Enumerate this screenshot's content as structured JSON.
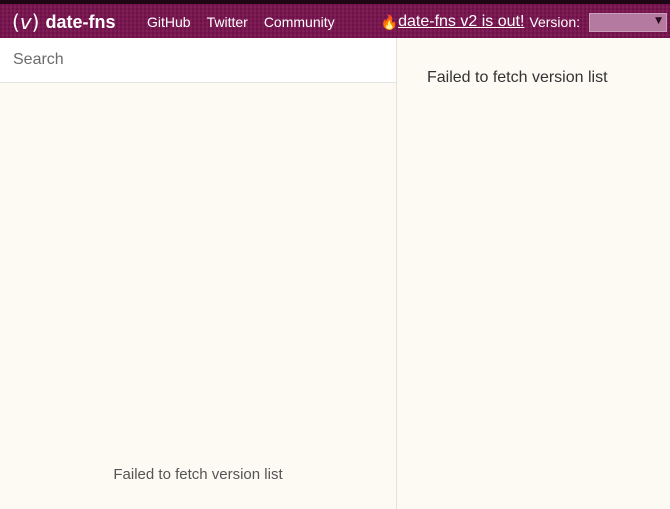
{
  "header": {
    "logo_icon": "(⁄)",
    "logo_text": "date-fns",
    "nav": [
      "GitHub",
      "Twitter",
      "Community"
    ],
    "announcement_icon": "fire-icon",
    "announcement": "date-fns v2 is out!",
    "version_label": "Version:",
    "version_selected": ""
  },
  "sidebar": {
    "search_placeholder": "Search",
    "message": "Failed to fetch version list"
  },
  "content": {
    "message": "Failed to fetch version list"
  },
  "colors": {
    "header_bg": "#7a1350",
    "page_bg": "#fdfaf4"
  }
}
